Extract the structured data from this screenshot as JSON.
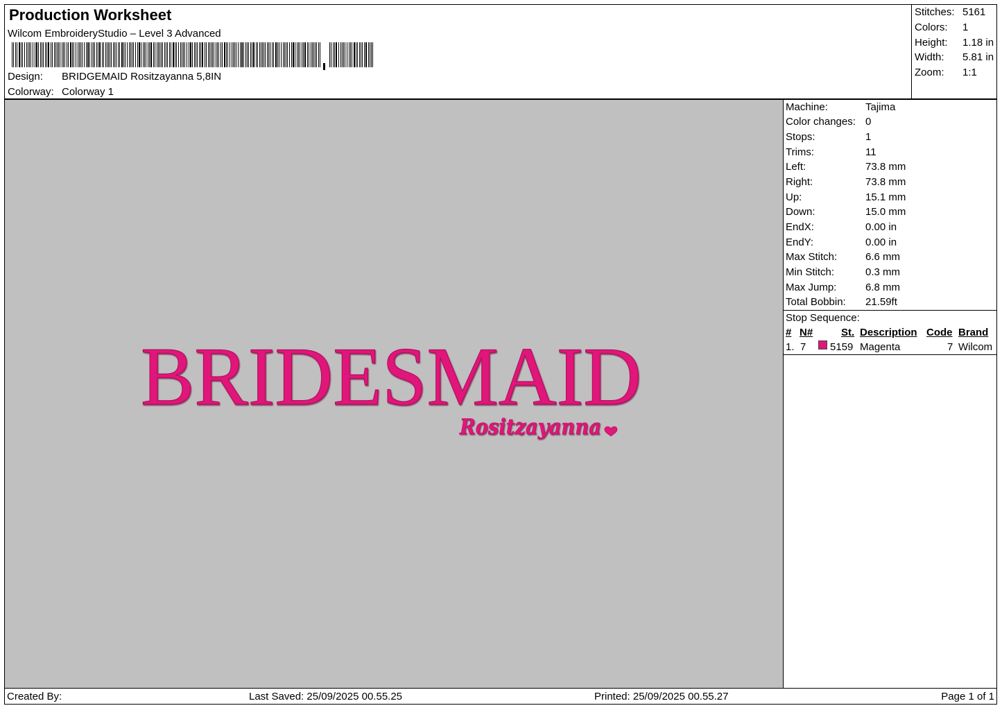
{
  "header": {
    "title": "Production Worksheet",
    "subtitle": "Wilcom EmbroideryStudio – Level 3 Advanced",
    "design_label": "Design:",
    "design_value": "BRIDGEMAID Rositzayanna 5,8IN",
    "colorway_label": "Colorway:",
    "colorway_value": "Colorway 1"
  },
  "stats": [
    {
      "label": "Stitches:",
      "value": "5161"
    },
    {
      "label": "Colors:",
      "value": "1"
    },
    {
      "label": "Height:",
      "value": "1.18 in"
    },
    {
      "label": "Width:",
      "value": "5.81 in"
    },
    {
      "label": "Zoom:",
      "value": "1:1"
    }
  ],
  "design": {
    "main_text": "BRIDESMAID",
    "script_text": "Rositzayanna",
    "thread_color": "#e0177a",
    "background_color": "#c0c0c0",
    "heart_icon": "heart-icon"
  },
  "properties": [
    {
      "label": "Machine:",
      "value": "Tajima"
    },
    {
      "label": "Color changes:",
      "value": "0"
    },
    {
      "label": "Stops:",
      "value": "1"
    },
    {
      "label": "Trims:",
      "value": "11"
    },
    {
      "label": "Left:",
      "value": "73.8 mm"
    },
    {
      "label": "Right:",
      "value": "73.8 mm"
    },
    {
      "label": "Up:",
      "value": "15.1 mm"
    },
    {
      "label": "Down:",
      "value": "15.0 mm"
    },
    {
      "label": "EndX:",
      "value": "0.00 in"
    },
    {
      "label": "EndY:",
      "value": "0.00 in"
    },
    {
      "label": "Max Stitch:",
      "value": "6.6 mm"
    },
    {
      "label": "Min Stitch:",
      "value": "0.3 mm"
    },
    {
      "label": "Max Jump:",
      "value": "6.8 mm"
    },
    {
      "label": "Total Bobbin:",
      "value": "21.59ft"
    }
  ],
  "stop_sequence": {
    "title": "Stop Sequence:",
    "columns": [
      "#",
      "N#",
      "St.",
      "Description",
      "Code",
      "Brand"
    ],
    "rows": [
      {
        "num": "1.",
        "n": "7",
        "st": "5159",
        "description": "Magenta",
        "code": "7",
        "brand": "Wilcom",
        "color": "#e0177a"
      }
    ]
  },
  "footer": {
    "created_by": "Created By:",
    "last_saved": "Last Saved: 25/09/2025 00.55.25",
    "printed": "Printed: 25/09/2025 00.55.27",
    "page": "Page 1 of 1"
  }
}
